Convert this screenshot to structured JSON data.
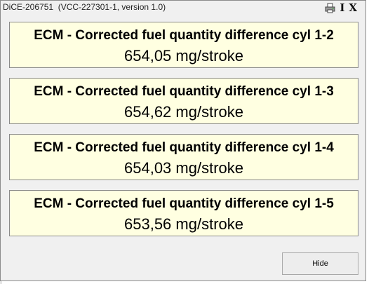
{
  "window": {
    "title": "DiCE-206751  (VCC-227301-1, version 1.0)",
    "icons": {
      "print": "printer-icon",
      "info_label": "I",
      "close_label": "X"
    }
  },
  "readings": [
    {
      "title": "ECM - Corrected fuel quantity difference cyl 1-2",
      "value": "654,05 mg/stroke"
    },
    {
      "title": "ECM - Corrected fuel quantity difference cyl 1-3",
      "value": "654,62 mg/stroke"
    },
    {
      "title": "ECM - Corrected fuel quantity difference cyl 1-4",
      "value": "654,03 mg/stroke"
    },
    {
      "title": "ECM - Corrected fuel quantity difference cyl 1-5",
      "value": "653,56 mg/stroke"
    }
  ],
  "footer": {
    "hide_label": "Hide"
  },
  "colors": {
    "panel_background": "#ffffe1",
    "window_background": "#f0f0f0"
  }
}
